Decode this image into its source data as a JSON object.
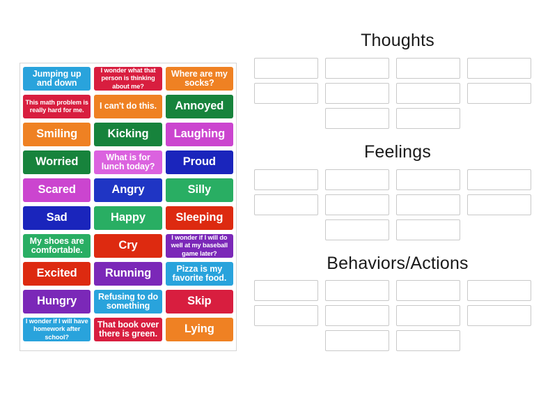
{
  "activity": {
    "type": "drag-and-drop-sorting"
  },
  "tiles": [
    {
      "text": "Jumping up and down",
      "color": "#29A3DC",
      "size": "medium"
    },
    {
      "text": "I wonder what that person is thinking about me?",
      "color": "#D81E3F",
      "size": "long"
    },
    {
      "text": "Where are my socks?",
      "color": "#EF8123",
      "size": "medium"
    },
    {
      "text": "This math problem is really hard for me.",
      "color": "#D81E3F",
      "size": "long"
    },
    {
      "text": "I can't do this.",
      "color": "#EF8123",
      "size": "medium"
    },
    {
      "text": "Annoyed",
      "color": "#17833C",
      "size": "short"
    },
    {
      "text": "Smiling",
      "color": "#EF8123",
      "size": "short"
    },
    {
      "text": "Kicking",
      "color": "#17833C",
      "size": "short"
    },
    {
      "text": "Laughing",
      "color": "#CB45CF",
      "size": "short"
    },
    {
      "text": "Worried",
      "color": "#17833C",
      "size": "short"
    },
    {
      "text": "What is for lunch today?",
      "color": "#DB62DF",
      "size": "medium"
    },
    {
      "text": "Proud",
      "color": "#1A25BC",
      "size": "short"
    },
    {
      "text": "Scared",
      "color": "#CB45CF",
      "size": "short"
    },
    {
      "text": "Angry",
      "color": "#1F35C4",
      "size": "short"
    },
    {
      "text": "Silly",
      "color": "#29AE63",
      "size": "short"
    },
    {
      "text": "Sad",
      "color": "#1A25BC",
      "size": "short"
    },
    {
      "text": "Happy",
      "color": "#29AE63",
      "size": "short"
    },
    {
      "text": "Sleeping",
      "color": "#DD2A10",
      "size": "short"
    },
    {
      "text": "My shoes are comfortable.",
      "color": "#29AE63",
      "size": "medium"
    },
    {
      "text": "Cry",
      "color": "#DD2A10",
      "size": "short"
    },
    {
      "text": "I wonder if I will do well at my baseball game later?",
      "color": "#7B28B8",
      "size": "long"
    },
    {
      "text": "Excited",
      "color": "#DD2A10",
      "size": "short"
    },
    {
      "text": "Running",
      "color": "#7B28B8",
      "size": "short"
    },
    {
      "text": "Pizza is my favorite food.",
      "color": "#29A3DC",
      "size": "medium"
    },
    {
      "text": "Hungry",
      "color": "#7B28B8",
      "size": "short"
    },
    {
      "text": "Refusing to do something",
      "color": "#29A3DC",
      "size": "medium"
    },
    {
      "text": "Skip",
      "color": "#D81E3F",
      "size": "short"
    },
    {
      "text": "I wonder if I will have homework after school?",
      "color": "#29A3DC",
      "size": "long"
    },
    {
      "text": "That book over there is green.",
      "color": "#D81E3F",
      "size": "medium"
    },
    {
      "text": "Lying",
      "color": "#EF8123",
      "size": "short"
    }
  ],
  "zones": [
    {
      "title": "Thoughts",
      "rows": [
        {
          "slots": 4,
          "start": 1
        },
        {
          "slots": 4,
          "start": 1
        },
        {
          "slots": 2,
          "start": 2
        }
      ]
    },
    {
      "title": "Feelings",
      "rows": [
        {
          "slots": 4,
          "start": 1
        },
        {
          "slots": 4,
          "start": 1
        },
        {
          "slots": 2,
          "start": 2
        }
      ]
    },
    {
      "title": "Behaviors/Actions",
      "rows": [
        {
          "slots": 4,
          "start": 1
        },
        {
          "slots": 4,
          "start": 1
        },
        {
          "slots": 2,
          "start": 2
        }
      ]
    }
  ],
  "colors": {
    "blue_light": "#29A3DC",
    "red": "#D81E3F",
    "orange": "#EF8123",
    "green_dark": "#17833C",
    "green_medium": "#29AE63",
    "magenta": "#CB45CF",
    "blue_deep": "#1A25BC",
    "vermillion": "#DD2A10",
    "purple": "#7B28B8",
    "slot_border": "#C8C8C8",
    "panel_border": "#D5D5D5"
  }
}
